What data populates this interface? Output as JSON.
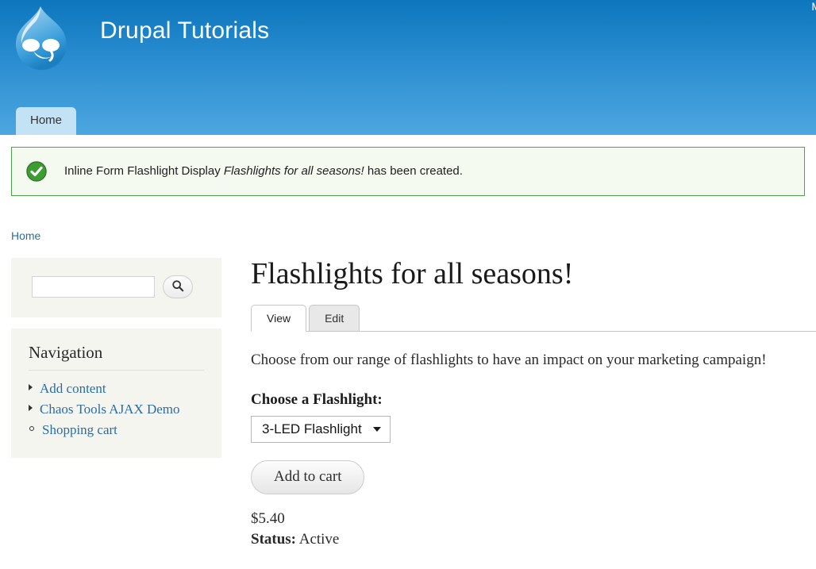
{
  "header": {
    "site_title": "Drupal Tutorials",
    "logo_icon": "drupal-droplet-logo",
    "user_menu_label": "M",
    "menu": [
      {
        "label": "Home",
        "active": true
      }
    ]
  },
  "status_message": {
    "icon": "success-check-icon",
    "prefix": "Inline Form Flashlight Display",
    "emphasis": "Flashlights for all seasons!",
    "suffix": "has been created.",
    "border_color": "#4aa24a",
    "background_color": "#f4faef"
  },
  "breadcrumb": {
    "items": [
      {
        "label": "Home"
      }
    ]
  },
  "sidebar": {
    "search": {
      "value": "",
      "placeholder": "",
      "button_icon": "search-icon"
    },
    "navigation": {
      "title": "Navigation",
      "items": [
        {
          "label": "Add content",
          "bullet": "arrow"
        },
        {
          "label": "Chaos Tools AJAX Demo",
          "bullet": "arrow"
        },
        {
          "label": "Shopping cart",
          "bullet": "circle"
        }
      ]
    }
  },
  "main": {
    "page_title": "Flashlights for all seasons!",
    "tabs": [
      {
        "label": "View",
        "active": true
      },
      {
        "label": "Edit",
        "active": false
      }
    ],
    "description": "Choose from our range of flashlights to have an impact on your marketing campaign!",
    "form": {
      "select_label": "Choose a Flashlight:",
      "select_value": "3-LED Flashlight",
      "submit_label": "Add to cart"
    },
    "price": "$5.40",
    "status_label": "Status:",
    "status_value": "Active"
  },
  "colors": {
    "header_gradient_top": "#0d76bd",
    "header_gradient_bottom": "#4da6e0",
    "link": "#2b6ca3",
    "menu_tab_bg": "#c3e2f4",
    "block_bg": "#f5f5f0"
  }
}
